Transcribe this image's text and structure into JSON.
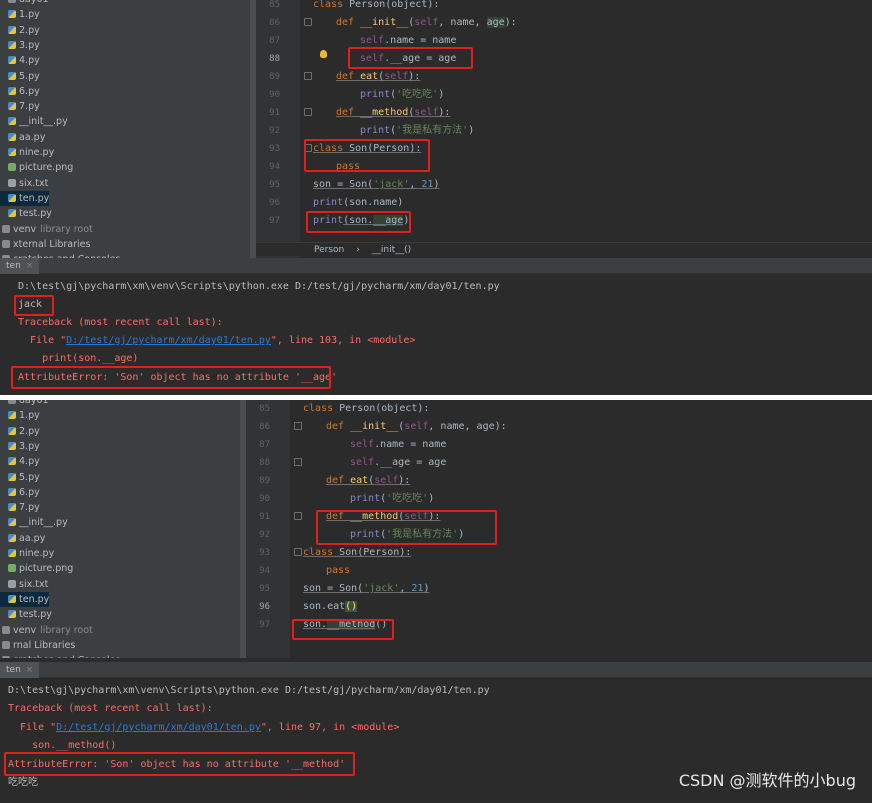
{
  "pane1": {
    "tree": [
      {
        "label": "day01",
        "kind": "fld"
      },
      {
        "label": "1.py",
        "kind": "py"
      },
      {
        "label": "2.py",
        "kind": "py"
      },
      {
        "label": "3.py",
        "kind": "py"
      },
      {
        "label": "4.py",
        "kind": "py"
      },
      {
        "label": "5.py",
        "kind": "py"
      },
      {
        "label": "6.py",
        "kind": "py"
      },
      {
        "label": "7.py",
        "kind": "py"
      },
      {
        "label": "__init__.py",
        "kind": "py"
      },
      {
        "label": "aa.py",
        "kind": "py"
      },
      {
        "label": "nine.py",
        "kind": "py"
      },
      {
        "label": "picture.png",
        "kind": "img"
      },
      {
        "label": "six.txt",
        "kind": "txt"
      },
      {
        "label": "ten.py",
        "kind": "py",
        "selected": true
      },
      {
        "label": "test.py",
        "kind": "py"
      },
      {
        "label": "venv",
        "kind": "fld",
        "muted": "library root"
      },
      {
        "label": "xternal Libraries",
        "kind": "fld"
      },
      {
        "label": "cratches and Consoles",
        "kind": "fld"
      }
    ],
    "line_numbers": [
      "85",
      "86",
      "87",
      "88",
      "89",
      "90",
      "91",
      "92",
      "93",
      "94",
      "95",
      "96",
      "97"
    ],
    "code": {
      "l85a": "class ",
      "l85b": "Person",
      "l85c": "(object):",
      "l86a": "def ",
      "l86b": "__init__",
      "l86c": "(",
      "l86d": "self",
      ", ": "",
      "l86e": ", name, ",
      "l86f": "age",
      "l86g": "):",
      "l87a": "self",
      ".name": "",
      "l87b": ".name = name",
      "l88a": "self",
      "l88b": ".__age = age",
      "l89a": "def ",
      "l89b": "eat",
      "l89c": "(",
      "l89d": "self",
      "l89e": "):",
      "l90a": "print",
      "l90b": "(",
      "l90c": "'吃吃吃'",
      "l90d": ")",
      "l91a": "def ",
      "l91b": "__method",
      "l91c": "(",
      "l91d": "self",
      "l91e": "):",
      "l92a": "print",
      "l92b": "(",
      "l92c": "'我是私有方法'",
      "l92d": ")",
      "l93a": "class ",
      "l93b": "Son",
      "l93c": "(Person):",
      "l94": "pass",
      "l95a": "son = Son(",
      "l95b": "'jack'",
      "l95c": ", ",
      "l95d": "21",
      "l95e": ")",
      "l96a": "print",
      "l96b": "(son.name)",
      "l97a": "print",
      "l97b": "(son.",
      "l97c": "__age",
      "l97d": ")"
    },
    "breadcrumb": [
      "Person",
      "__init__()"
    ],
    "run_tab": "ten",
    "console": {
      "cmd": "D:\\test\\gj\\pycharm\\xm\\venv\\Scripts\\python.exe D:/test/gj/pycharm/xm/day01/ten.py",
      "out1": "jack",
      "tb": "Traceback (most recent call last):",
      "file_pre": "  File \"",
      "file_link": "D:/test/gj/pycharm/xm/day01/ten.py",
      "file_post": "\", line 103, in <module>",
      "src": "    print(son.__age)",
      "err": "AttributeError: 'Son' object has no attribute '__age'"
    }
  },
  "pane2": {
    "tree": [
      {
        "label": "day01",
        "kind": "fld"
      },
      {
        "label": "1.py",
        "kind": "py"
      },
      {
        "label": "2.py",
        "kind": "py"
      },
      {
        "label": "3.py",
        "kind": "py"
      },
      {
        "label": "4.py",
        "kind": "py"
      },
      {
        "label": "5.py",
        "kind": "py"
      },
      {
        "label": "6.py",
        "kind": "py"
      },
      {
        "label": "7.py",
        "kind": "py"
      },
      {
        "label": "__init__.py",
        "kind": "py"
      },
      {
        "label": "aa.py",
        "kind": "py"
      },
      {
        "label": "nine.py",
        "kind": "py"
      },
      {
        "label": "picture.png",
        "kind": "img"
      },
      {
        "label": "six.txt",
        "kind": "txt"
      },
      {
        "label": "ten.py",
        "kind": "py",
        "selected": true
      },
      {
        "label": "test.py",
        "kind": "py"
      },
      {
        "label": "venv",
        "kind": "fld",
        "muted": "library root"
      },
      {
        "label": "rnal Libraries",
        "kind": "fld"
      },
      {
        "label": "cratches and Consoles",
        "kind": "fld"
      }
    ],
    "line_numbers": [
      "85",
      "86",
      "87",
      "88",
      "89",
      "90",
      "91",
      "92",
      "93",
      "94",
      "95",
      "96",
      "97"
    ],
    "code": {
      "l85a": "class ",
      "l85b": "Person",
      "l85c": "(object):",
      "l86a": "def ",
      "l86b": "__init__",
      "l86c": "(",
      "l86d": "self",
      "l86e": ", name, age):",
      "l87a": "self",
      "l87b": ".name = name",
      "l88a": "self",
      "l88b": ".__age = age",
      "l89a": "def ",
      "l89b": "eat",
      "l89c": "(",
      "l89d": "self",
      "l89e": "):",
      "l90a": "print",
      "l90b": "(",
      "l90c": "'吃吃吃'",
      "l90d": ")",
      "l91a": "def ",
      "l91b": "__method",
      "l91c": "(",
      "l91d": "self",
      "l91e": "):",
      "l92a": "print",
      "l92b": "(",
      "l92c": "'我是私有方法'",
      "l92d": ")",
      "l93a": "class ",
      "l93b": "Son",
      "l93c": "(Person):",
      "l94": "pass",
      "l95a": "son = Son(",
      "l95b": "'jack'",
      "l95c": ", ",
      "l95d": "21",
      "l95e": ")",
      "l96a": "son.eat",
      "l96b": "()",
      "l97a": "son.",
      "l97b": "__method",
      "l97c": "()"
    },
    "run_tab": "ten",
    "console": {
      "cmd": "D:\\test\\gj\\pycharm\\xm\\venv\\Scripts\\python.exe D:/test/gj/pycharm/xm/day01/ten.py",
      "tb": "Traceback (most recent call last):",
      "file_pre": "  File \"",
      "file_link": "D:/test/gj/pycharm/xm/day01/ten.py",
      "file_post": "\", line 97, in <module>",
      "src": "    son.__method()",
      "err": "AttributeError: 'Son' object has no attribute '__method'",
      "out1": "吃吃吃"
    }
  },
  "watermark": "CSDN @测软件的小bug",
  "colors": {
    "highlight_box": "#e0201d",
    "error": "#ff6b68",
    "link": "#287bde",
    "keyword": "#cc7832",
    "string": "#6a8759",
    "self": "#94558d"
  }
}
